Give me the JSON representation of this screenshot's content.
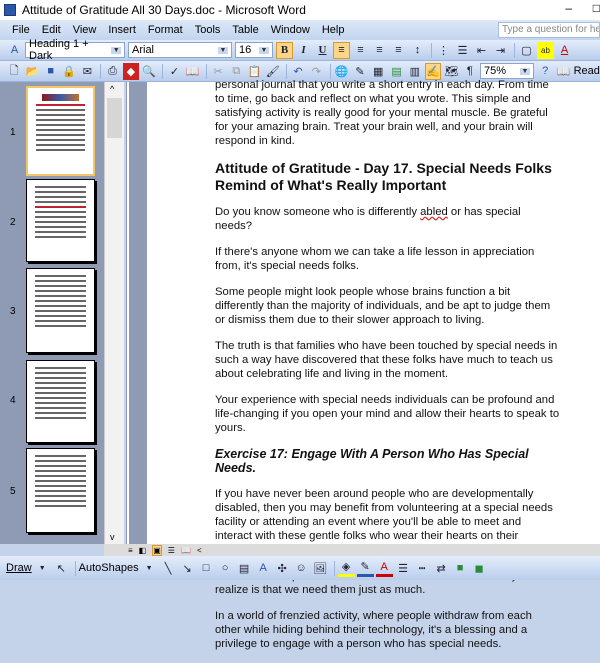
{
  "window": {
    "title": "Attitude of Gratitude All 30 Days.doc - Microsoft Word",
    "minimize": "–",
    "maximize": "□"
  },
  "menu": {
    "items": [
      "File",
      "Edit",
      "View",
      "Insert",
      "Format",
      "Tools",
      "Table",
      "Window",
      "Help"
    ],
    "help_placeholder": "Type a question for help"
  },
  "formatting": {
    "style": "Heading 1 + Dark",
    "font": "Arial",
    "size": "16",
    "bold": "B",
    "italic": "I",
    "underline": "U",
    "active": [
      "bold",
      "align-left"
    ]
  },
  "standard": {
    "zoom": "75%",
    "read": "Read"
  },
  "thumbnails": {
    "pages": [
      "1",
      "2",
      "3",
      "4",
      "5"
    ],
    "selected": "1"
  },
  "document": {
    "intro": "personal journal that you write a short entry in each day. From time to time, go back and reflect on what you wrote. This simple and satisfying activity is really good for your mental muscle. Be grateful for your amazing brain. Treat your brain well, and your brain will respond in kind.",
    "heading": "Attitude of Gratitude - Day 17. Special Needs Folks Remind of What's Really Important",
    "p1a": "Do you know someone who is differently ",
    "p1b": "abled",
    "p1c": " or has special needs?",
    "p2": "If there's anyone whom we can take a life lesson in appreciation from, it's special needs folks.",
    "p3": "Some people might look people whose brains function a bit differently than the majority of individuals, and be apt to judge them or dismiss them due to their slower approach to living.",
    "p4": "The truth is that families who have been touched by special needs in such a way have discovered that these folks have much to teach us about celebrating life and living in the moment.",
    "p5": "Your experience with special needs individuals can be profound and life-changing if you open your mind and allow their hearts to speak to yours.",
    "exercise": "Exercise 17: Engage With A Person Who Has Special Needs.",
    "p6": "If you have never been around people who are developmentally disabled, then you may benefit from volunteering at a special needs facility or attending an event where you'll be able to meet and interact with these gentle folks who wear their hearts on their sleeves.",
    "p7": "We know that special needs folks need us. But what we may not realize is that we need them just as much.",
    "p8": "In a world of frenzied activity, where people withdraw from each other while hiding behind their technology, it's a blessing and a privilege to engage with a person who has special needs."
  },
  "drawing": {
    "draw": "Draw",
    "autoshapes": "AutoShapes"
  },
  "colors": {
    "accent": "#fbd689",
    "toolbar": "#c5d3ea",
    "pane": "#8f9bb5"
  }
}
